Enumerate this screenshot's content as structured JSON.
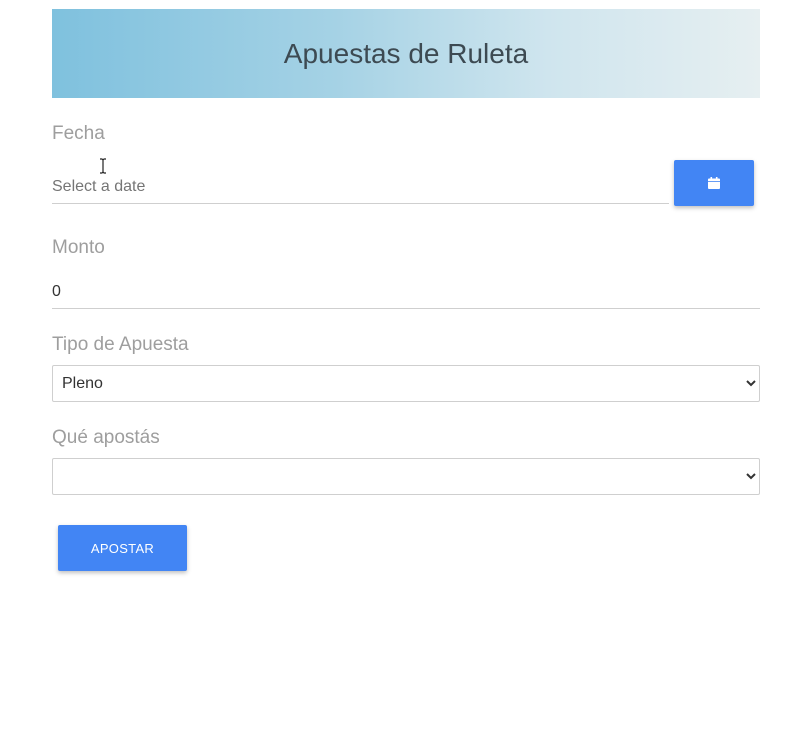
{
  "header": {
    "title": "Apuestas de Ruleta"
  },
  "fecha": {
    "label": "Fecha",
    "placeholder": "Select a date",
    "value": "",
    "button_icon": "calendar-icon"
  },
  "monto": {
    "label": "Monto",
    "value": "0"
  },
  "tipo": {
    "label": "Tipo de Apuesta",
    "selected": "Pleno"
  },
  "que": {
    "label": "Qué apostás",
    "selected": ""
  },
  "actions": {
    "submit_label": "APOSTAR"
  },
  "colors": {
    "accent": "#4285f4",
    "label": "#9e9e9e",
    "header_start": "#7fc1de",
    "header_end": "#e6eff1"
  }
}
